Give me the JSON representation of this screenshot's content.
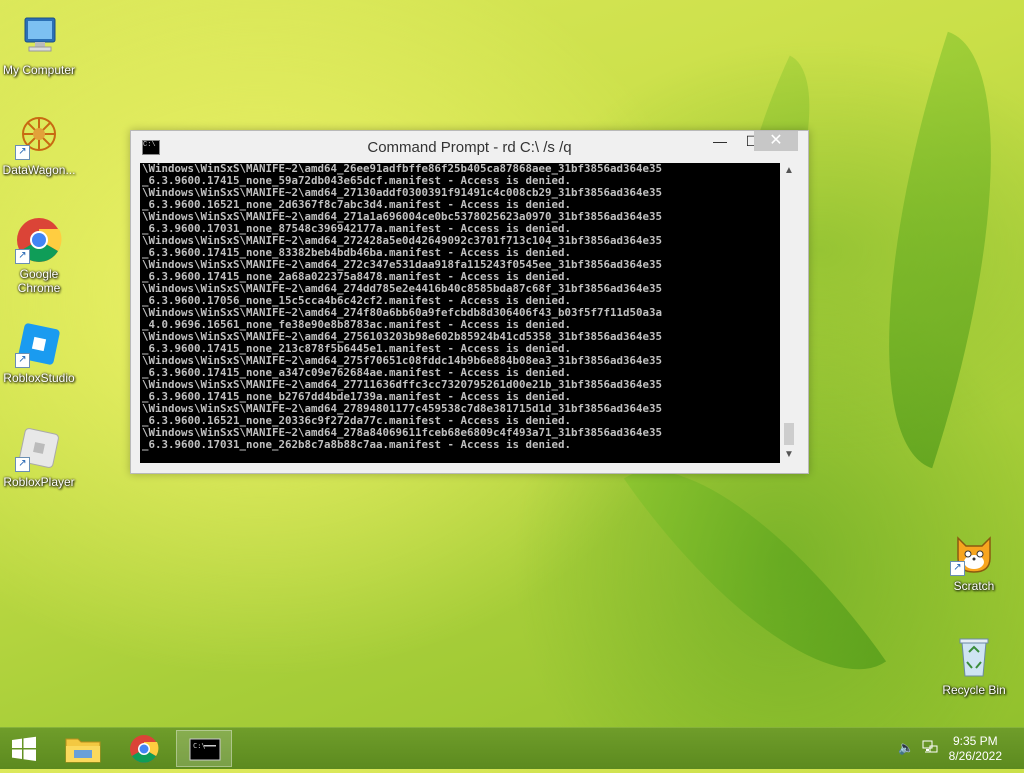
{
  "desktop": {
    "icons": [
      {
        "label": "My Computer"
      },
      {
        "label": "DataWagon..."
      },
      {
        "label": "Google Chrome"
      },
      {
        "label": "RobloxStudio"
      },
      {
        "label": "RobloxPlayer"
      },
      {
        "label": "Scratch"
      },
      {
        "label": "Recycle Bin"
      }
    ]
  },
  "window": {
    "title": "Command Prompt - rd  C:\\ /s /q",
    "minimize": "—",
    "maximize": "☐",
    "close": "✕",
    "console_text": "\\Windows\\WinSxS\\MANIFE~2\\amd64_26ee91adfbffe86f25b405ca87868aee_31bf3856ad364e35\n_6.3.9600.17415_none_59a72db043e65dcf.manifest - Access is denied.\n\\Windows\\WinSxS\\MANIFE~2\\amd64_27130addf0300391f91491c4c008cb29_31bf3856ad364e35\n_6.3.9600.16521_none_2d6367f8c7abc3d4.manifest - Access is denied.\n\\Windows\\WinSxS\\MANIFE~2\\amd64_271a1a696004ce0bc5378025623a0970_31bf3856ad364e35\n_6.3.9600.17031_none_87548c396942177a.manifest - Access is denied.\n\\Windows\\WinSxS\\MANIFE~2\\amd64_272428a5e0d42649092c3701f713c104_31bf3856ad364e35\n_6.3.9600.17415_none_83382beb4bdb46ba.manifest - Access is denied.\n\\Windows\\WinSxS\\MANIFE~2\\amd64_272c347e531daa918fa115243f0545ee_31bf3856ad364e35\n_6.3.9600.17415_none_2a68a022375a8478.manifest - Access is denied.\n\\Windows\\WinSxS\\MANIFE~2\\amd64_274dd785e2e4416b40c8585bda87c68f_31bf3856ad364e35\n_6.3.9600.17056_none_15c5cca4b6c42cf2.manifest - Access is denied.\n\\Windows\\WinSxS\\MANIFE~2\\amd64_274f80a6bb60a9fefcbdb8d306406f43_b03f5f7f11d50a3a\n_4.0.9696.16561_none_fe38e90e8b8783ac.manifest - Access is denied.\n\\Windows\\WinSxS\\MANIFE~2\\amd64_2756103203b98e602b85924b41cd5358_31bf3856ad364e35\n_6.3.9600.17415_none_213c878f5b6445e1.manifest - Access is denied.\n\\Windows\\WinSxS\\MANIFE~2\\amd64_275f70651c08fddc14b9b6e884b08ea3_31bf3856ad364e35\n_6.3.9600.17415_none_a347c09e762684ae.manifest - Access is denied.\n\\Windows\\WinSxS\\MANIFE~2\\amd64_27711636dffc3cc7320795261d00e21b_31bf3856ad364e35\n_6.3.9600.17415_none_b2767dd4bde1739a.manifest - Access is denied.\n\\Windows\\WinSxS\\MANIFE~2\\amd64_27894801177c459538c7d8e381715d1d_31bf3856ad364e35\n_6.3.9600.16521_none_20336c9f272da77c.manifest - Access is denied.\n\\Windows\\WinSxS\\MANIFE~2\\amd64_278a84069611fceb68e6809c4f493a71_31bf3856ad364e35\n_6.3.9600.17031_none_262b8c7a8b88c7aa.manifest - Access is denied."
  },
  "taskbar": {
    "clock_time": "9:35 PM",
    "clock_date": "8/26/2022"
  }
}
